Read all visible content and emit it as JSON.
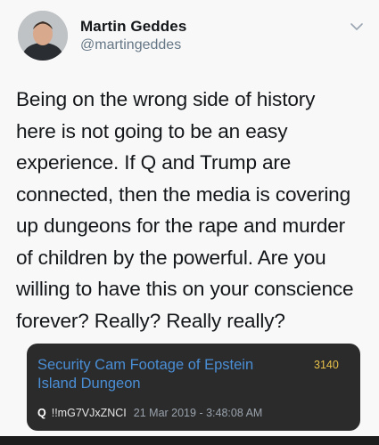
{
  "author": {
    "name": "Martin Geddes",
    "handle": "@martingeddes"
  },
  "tweet": {
    "text": "Being on the wrong side of history\nhere is not going to be an easy\nexperience. If Q and Trump are\nconnected, then the media is covering\nup dungeons for the rape and murder\nof children by the powerful. Are you\nwilling to have this on your conscience\nforever? Really? Really really?"
  },
  "card": {
    "title_line1": "Security Cam Footage of Epstein",
    "title_line2": "Island Dungeon",
    "count": "3140",
    "badge": "Q",
    "user": "!!mG7VJxZNCI",
    "date": "21 Mar 2019 - 3:48:08 AM"
  },
  "icons": {
    "menu": "chevron-down-icon"
  }
}
